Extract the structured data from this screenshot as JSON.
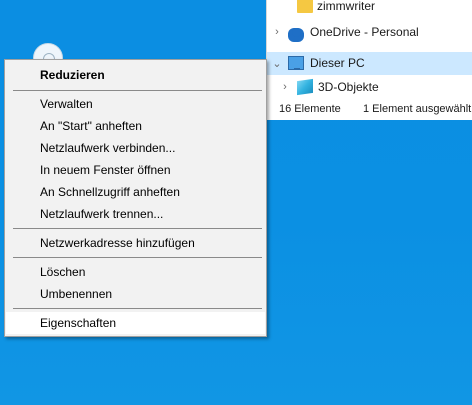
{
  "explorer": {
    "nav_items": [
      {
        "label": "zimmwriter"
      },
      {
        "label": "OneDrive - Personal"
      },
      {
        "label": "Dieser PC"
      },
      {
        "label": "3D-Objekte"
      }
    ],
    "status_count": "16 Elemente",
    "status_selected": "1 Element ausgewählt",
    "selected_color": "#cce8ff"
  },
  "context_menu": {
    "items": [
      {
        "label": "Reduzieren"
      },
      {
        "label": "Verwalten"
      },
      {
        "label": "An \"Start\" anheften"
      },
      {
        "label": "Netzlaufwerk verbinden..."
      },
      {
        "label": "In neuem Fenster öffnen"
      },
      {
        "label": "An Schnellzugriff anheften"
      },
      {
        "label": "Netzlaufwerk trennen..."
      },
      {
        "label": "Netzwerkadresse hinzufügen"
      },
      {
        "label": "Löschen"
      },
      {
        "label": "Umbenennen"
      },
      {
        "label": "Eigenschaften"
      }
    ]
  },
  "colors": {
    "desktop": "#0b8ee2",
    "menu_bg": "#f2f2f2"
  }
}
